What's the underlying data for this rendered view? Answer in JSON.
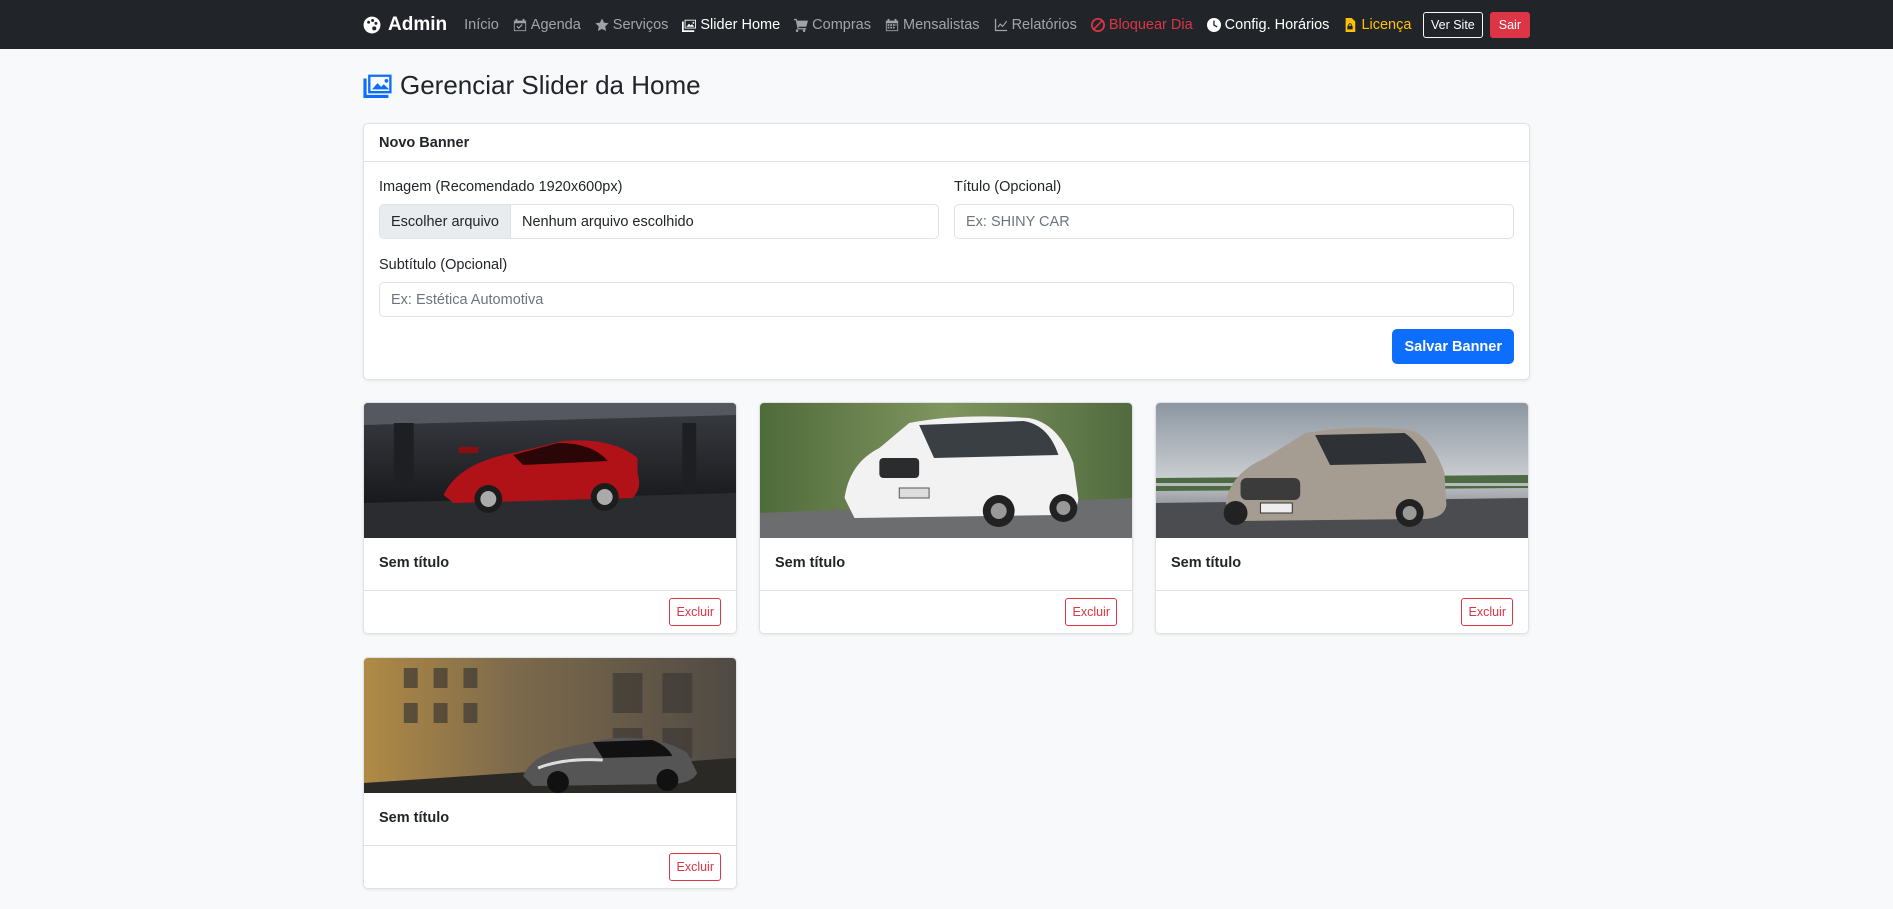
{
  "navbar": {
    "brand": "Admin",
    "links": [
      {
        "label": "Início",
        "icon": "none",
        "state": "normal"
      },
      {
        "label": "Agenda",
        "icon": "calendar-check-icon",
        "state": "normal"
      },
      {
        "label": "Serviços",
        "icon": "star-icon",
        "state": "normal"
      },
      {
        "label": "Slider Home",
        "icon": "images-icon",
        "state": "active"
      },
      {
        "label": "Compras",
        "icon": "cart-icon",
        "state": "normal"
      },
      {
        "label": "Mensalistas",
        "icon": "calendar-icon",
        "state": "normal"
      },
      {
        "label": "Relatórios",
        "icon": "chart-line-icon",
        "state": "normal"
      },
      {
        "label": "Bloquear Dia",
        "icon": "ban-icon",
        "state": "danger"
      },
      {
        "label": "Config. Horários",
        "icon": "clock-icon",
        "state": "white"
      },
      {
        "label": "Licença",
        "icon": "file-lock-icon",
        "state": "warning"
      }
    ],
    "view_site": "Ver Site",
    "logout": "Sair",
    "colors": {
      "danger": "#dc3545",
      "warning": "#ffc107",
      "background": "#212529"
    }
  },
  "page": {
    "title": "Gerenciar Slider da Home",
    "title_icon": "images-icon",
    "accent": "#0d6efd"
  },
  "form": {
    "header": "Novo Banner",
    "image_label": "Imagem (Recomendado 1920x600px)",
    "file_button": "Escolher arquivo",
    "file_status": "Nenhum arquivo escolhido",
    "title_label": "Título (Opcional)",
    "title_placeholder": "Ex: SHINY CAR",
    "subtitle_label": "Subtítulo (Opcional)",
    "subtitle_placeholder": "Ex: Estética Automotiva",
    "submit": "Salvar Banner"
  },
  "banners": [
    {
      "title": "Sem título",
      "image": "red-sports-car-photo",
      "delete": "Excluir"
    },
    {
      "title": "Sem título",
      "image": "white-suv-photo",
      "delete": "Excluir"
    },
    {
      "title": "Sem título",
      "image": "silver-hatchback-photo",
      "delete": "Excluir"
    },
    {
      "title": "Sem título",
      "image": "chrome-sports-car-photo",
      "delete": "Excluir"
    }
  ]
}
